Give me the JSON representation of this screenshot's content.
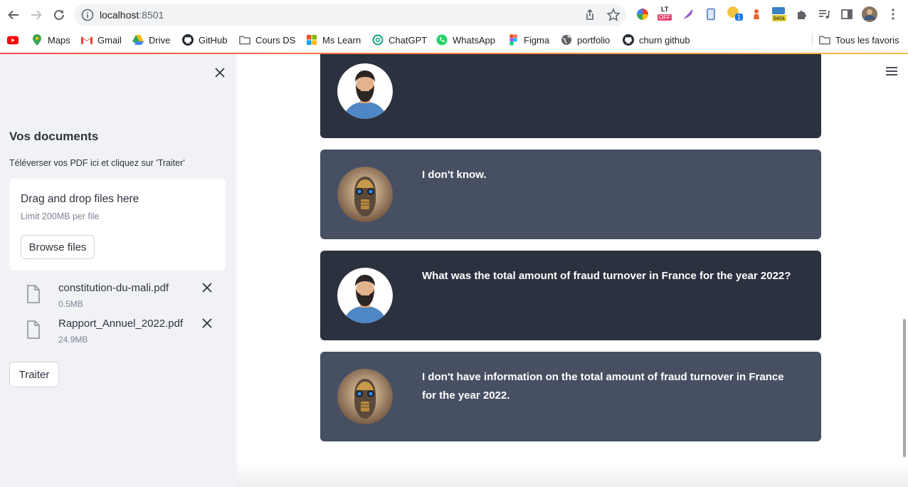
{
  "browser": {
    "url_host": "localhost",
    "url_port": ":8501",
    "extensions": {
      "lt_badge": "LT",
      "lt_off": "OFF",
      "notification_count": "1",
      "beta_label": "beta"
    },
    "bookmarks": [
      {
        "label": "",
        "icon": "youtube-icon"
      },
      {
        "label": "Maps",
        "icon": "maps-icon"
      },
      {
        "label": "Gmail",
        "icon": "gmail-icon"
      },
      {
        "label": "Drive",
        "icon": "drive-icon"
      },
      {
        "label": "GitHub",
        "icon": "github-icon"
      },
      {
        "label": "Cours DS",
        "icon": "folder-icon"
      },
      {
        "label": "Ms Learn",
        "icon": "microsoft-icon"
      },
      {
        "label": "ChatGPT",
        "icon": "chatgpt-icon"
      },
      {
        "label": "WhatsApp",
        "icon": "whatsapp-icon"
      },
      {
        "label": "Figma",
        "icon": "figma-icon"
      },
      {
        "label": "portfolio",
        "icon": "globe-icon"
      },
      {
        "label": "churn github",
        "icon": "github-icon"
      },
      {
        "label": "Tous les favoris",
        "icon": "folder-icon"
      }
    ]
  },
  "sidebar": {
    "title": "Vos documents",
    "subtitle": "Téléverser vos PDF ici et cliquez sur 'Traiter'",
    "dropzone": {
      "title": "Drag and drop files here",
      "limit": "Limit 200MB per file",
      "browse_label": "Browse files"
    },
    "files": [
      {
        "name": "constitution-du-mali.pdf",
        "size": "0.5MB"
      },
      {
        "name": "Rapport_Annuel_2022.pdf",
        "size": "24.9MB"
      }
    ],
    "process_label": "Traiter"
  },
  "chat": {
    "messages": [
      {
        "role": "user",
        "text": ""
      },
      {
        "role": "bot",
        "text": "I don't know."
      },
      {
        "role": "user",
        "text": "What was the total amount of fraud turnover in France for the year 2022?"
      },
      {
        "role": "bot",
        "text": "I don't have information on the total amount of fraud turnover in France for the year 2022."
      }
    ]
  },
  "colors": {
    "user_bubble": "#2b313e",
    "bot_bubble": "#475063",
    "sidebar_bg": "#f0f2f6",
    "accent_gradient_start": "#ff4b4b",
    "accent_gradient_end": "#ffbd45"
  }
}
